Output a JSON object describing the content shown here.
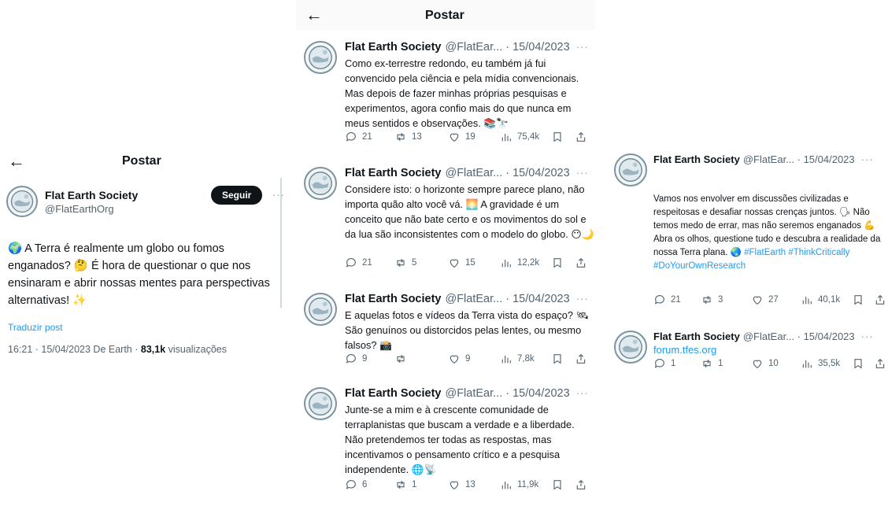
{
  "screen_title": "Postar",
  "left": {
    "name": "Flat Earth Society",
    "handle": "@FlatEarthOrg",
    "follow_label": "Seguir",
    "more": "···",
    "text": "🌍 A Terra é realmente um globo ou fomos enganados? 🤔 É hora de questionar o que nos ensinaram e abrir nossas mentes para perspectivas alternativas! ✨",
    "translate_label": "Traduzir post",
    "time_date": "16:21 · 15/04/2023 De Earth · ",
    "views_count": "83,1k",
    "views_label": " visualizações"
  },
  "middle": {
    "tweets": [
      {
        "name": "Flat Earth Society",
        "meta": "@FlatEar... · 15/04/2023",
        "more": "···",
        "text": "Como ex-terrestre redondo, eu também já fui convencido pela ciência e pela mídia convencionais. Mas depois de fazer minhas próprias pesquisas e experimentos, agora confio mais do que nunca em meus sentidos e observações. 📚🔭",
        "replies": "21",
        "retweets": "13",
        "likes": "19",
        "views": "75,4k"
      },
      {
        "name": "Flat Earth Society",
        "meta": "@FlatEar... · 15/04/2023",
        "more": "···",
        "text": "Considere isto: o horizonte sempre parece plano, não importa quão alto você vá. 🌅 A gravidade é um conceito que não bate certo e os movimentos do sol e da lua são inconsistentes com o modelo do globo. 😶🌙",
        "replies": "21",
        "retweets": "5",
        "likes": "15",
        "views": "12,2k"
      },
      {
        "name": "Flat Earth Society",
        "meta": "@FlatEar... · 15/04/2023",
        "more": "···",
        "text": "E aquelas fotos e vídeos da Terra vista do espaço? 🛰 São genuínos ou distorcidos pelas lentes, ou mesmo falsos? 📸",
        "replies": "9",
        "retweets": "",
        "likes": "9",
        "views": "7,8k"
      },
      {
        "name": "Flat Earth Society",
        "meta": "@FlatEar... · 15/04/2023",
        "more": "···",
        "text": "Junte-se a mim e à crescente comunidade de terraplanistas que buscam a verdade e a liberdade. Não pretendemos ter todas as respostas, mas incentivamos o pensamento crítico e a pesquisa independente. 🌐📡",
        "replies": "6",
        "retweets": "1",
        "likes": "13",
        "views": "11,9k"
      }
    ]
  },
  "right": {
    "tweets": [
      {
        "name": "Flat Earth Society",
        "meta": "@FlatEar... · 15/04/2023",
        "more": "···",
        "text_a": "Vamos nos envolver em discussões civilizadas e respeitosas e desafiar nossas crenças juntos. 🗣 Não temos medo de errar, mas não seremos enganados 💪",
        "text_b": "Abra os olhos, questione tudo e descubra a realidade da nossa Terra plana. 🌏 ",
        "hashtags": "#FlatEarth #ThinkCritically #DoYourOwnResearch",
        "replies": "21",
        "retweets": "3",
        "likes": "27",
        "views": "40,1k"
      },
      {
        "name": "Flat Earth Society",
        "meta": "@FlatEar... · 15/04/2023",
        "more": "···",
        "link": "forum.tfes.org",
        "replies": "1",
        "retweets": "1",
        "likes": "10",
        "views": "35,5k"
      }
    ]
  }
}
